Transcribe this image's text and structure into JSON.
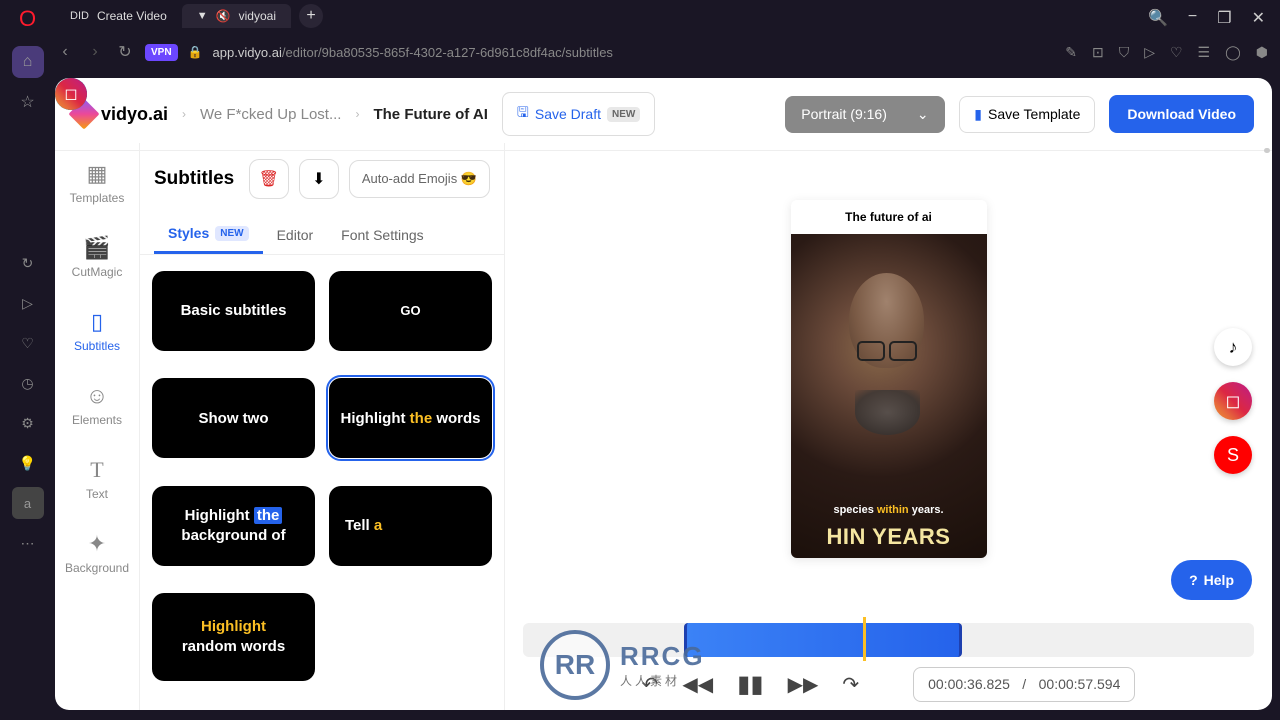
{
  "window": {
    "search": "search",
    "min": "−",
    "restore": "❐",
    "close": "✕"
  },
  "tabs": [
    {
      "icon": "DID",
      "label": "Create Video"
    },
    {
      "icon": "▼",
      "sound": "🔇",
      "label": "vidyoai"
    }
  ],
  "url": {
    "vpn": "VPN",
    "host": "app.vidyo.ai",
    "path": "/editor/9ba80535-865f-4302-a127-6d961c8df4ac/subtitles"
  },
  "header": {
    "brand": "vidyo.ai",
    "crumb1": "We F*cked Up Lost...",
    "crumb2": "The Future of AI",
    "save_draft": "Save Draft",
    "new": "NEW",
    "aspect": "Portrait (9:16)",
    "save_template": "Save Template",
    "download": "Download Video"
  },
  "nav": {
    "templates": "Templates",
    "cutmagic": "CutMagic",
    "subtitles": "Subtitles",
    "elements": "Elements",
    "text": "Text",
    "background": "Background"
  },
  "panel": {
    "title": "Subtitles",
    "emoji_btn": "Auto-add Emojis 😎",
    "tab_styles": "Styles",
    "tab_styles_badge": "NEW",
    "tab_editor": "Editor",
    "tab_font": "Font Settings"
  },
  "styles": {
    "s1": "Basic subtitles",
    "s2": "GO",
    "s3": "Show two",
    "s4_a": "Highlight ",
    "s4_b": "the",
    "s4_c": " words",
    "s5_a": "Highlight ",
    "s5_b": "the",
    "s5_c": " background of",
    "s6_a": "Tell ",
    "s6_b": "a",
    "s7_a": "Highlight",
    "s7_b": "random words"
  },
  "preview": {
    "title": "The future of ai",
    "subtitle_a": "species ",
    "subtitle_b": "within",
    "subtitle_c": " years.",
    "big": "HIN YEARS"
  },
  "help": "Help",
  "timecode": {
    "current": "00:00:36.825",
    "sep": "/",
    "total": "00:00:57.594"
  },
  "watermark": {
    "logo": "RR",
    "big": "RRCG",
    "sm": "人人素材"
  }
}
